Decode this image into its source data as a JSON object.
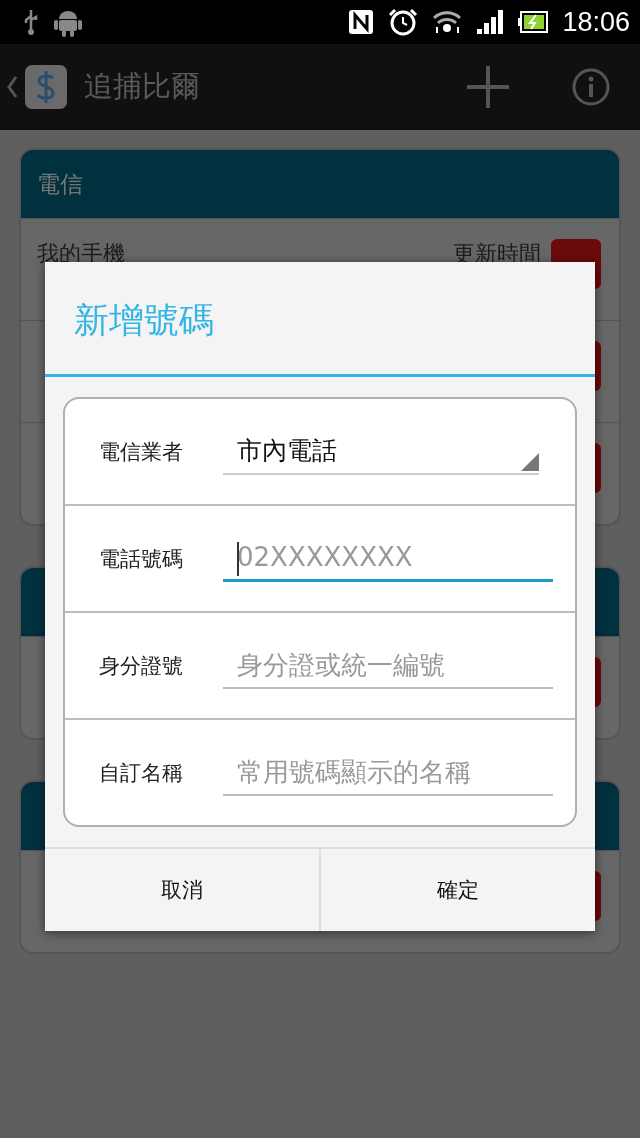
{
  "status_bar": {
    "time": "18:06"
  },
  "action_bar": {
    "title": "追捕比爾"
  },
  "background": {
    "cards": [
      {
        "header": "電信",
        "rows": [
          {
            "name": "我的手機",
            "updated": "更新時間"
          },
          {},
          {}
        ]
      },
      {
        "rows": [
          {}
        ]
      },
      {
        "rows": [
          {}
        ]
      }
    ]
  },
  "dialog": {
    "title": "新增號碼",
    "fields": [
      {
        "kind": "spinner",
        "label": "電信業者",
        "value": "市內電話",
        "focused": false
      },
      {
        "kind": "text",
        "label": "電話號碼",
        "placeholder": "02XXXXXXXX",
        "focused": true
      },
      {
        "kind": "text",
        "label": "身分證號",
        "placeholder": "身分證或統一編號",
        "focused": false
      },
      {
        "kind": "text",
        "label": "自訂名稱",
        "placeholder": "常用號碼顯示的名稱",
        "focused": false
      }
    ],
    "buttons": [
      "取消",
      "確定"
    ]
  }
}
